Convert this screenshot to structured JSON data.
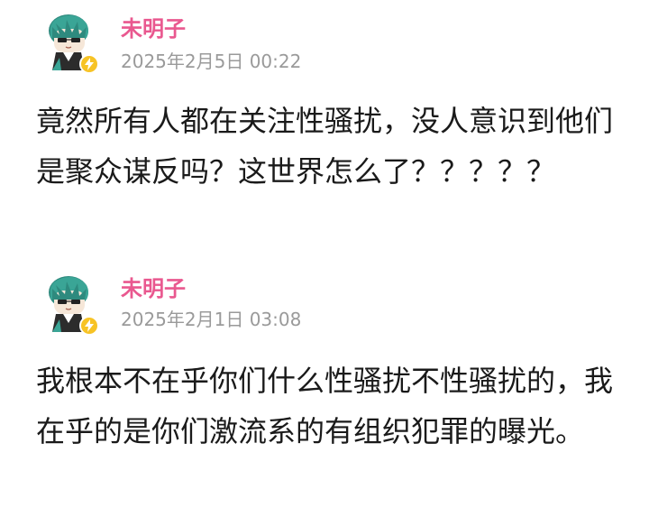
{
  "posts": [
    {
      "username": "未明子",
      "timestamp": "2025年2月5日 00:22",
      "content": "竟然所有人都在关注性骚扰，没人意识到他们是聚众谋反吗？这世界怎么了？？？？？"
    },
    {
      "username": "未明子",
      "timestamp": "2025年2月1日 03:08",
      "content": "我根本不在乎你们什么性骚扰不性骚扰的，我在乎的是你们激流系的有组织犯罪的曝光。"
    }
  ],
  "icons": {
    "avatar": "anime-character-avatar-icon",
    "badge": "lightning-icon"
  },
  "colors": {
    "username": "#e9588f",
    "timestamp": "#9a9a9a",
    "text": "#1a1a1a",
    "badge": "#f7c325"
  }
}
